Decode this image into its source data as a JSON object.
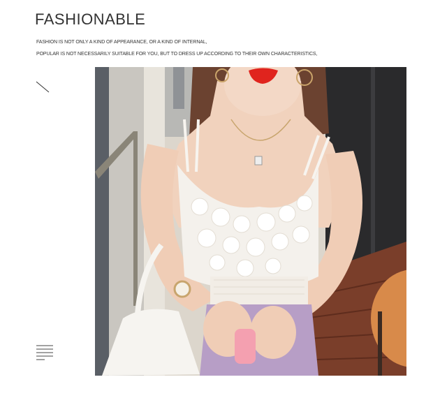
{
  "header": {
    "brand_title": "FASHIONABLE",
    "tagline_line1": "FASHION IS NOT ONLY A KIND OF APPEARANCE, OR A KIND OF INTERNAL,",
    "tagline_line2": "POPULAR IS NOT NECESSARILY SUITABLE FOR YOU, BUT TO DRESS UP ACCORDING TO THEIR OWN CHARACTERISTICS,"
  },
  "icons": {
    "diagonal": "diagonal-line-icon",
    "menu": "menu-lines-icon"
  },
  "photo": {
    "subject": "model-wearing-white-lace-camisole",
    "colors": {
      "top": "#f4f1ec",
      "skirt": "#b79ec6",
      "wall": "#d8d2c8",
      "floor": "#7a3e2a",
      "hair": "#6b4230",
      "lips": "#e0241e"
    }
  }
}
